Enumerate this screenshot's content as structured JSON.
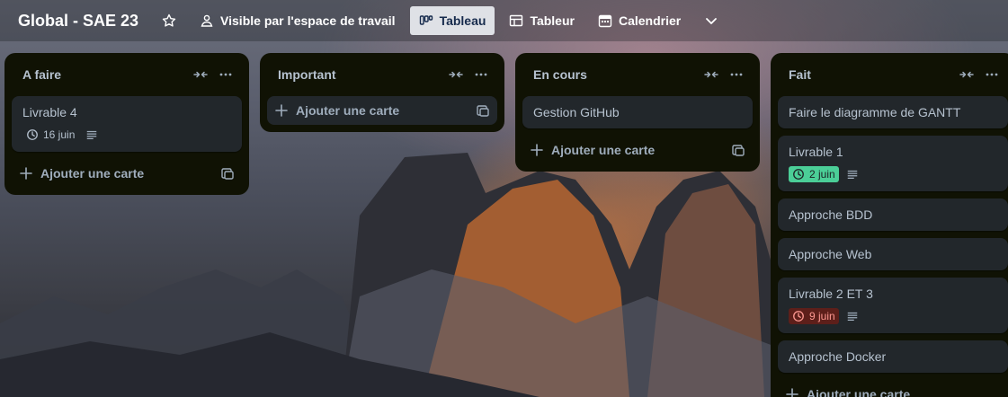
{
  "board": {
    "title": "Global - SAE 23",
    "visibility": "Visible par l'espace de travail",
    "views": [
      {
        "label": "Tableau",
        "active": true
      },
      {
        "label": "Tableur",
        "active": false
      },
      {
        "label": "Calendrier",
        "active": false
      }
    ]
  },
  "common": {
    "add_card": "Ajouter une carte"
  },
  "lists": [
    {
      "title": "A faire",
      "cards": [
        {
          "title": "Livrable 4",
          "due": "16 juin",
          "due_status": "normal",
          "has_description": true
        }
      ]
    },
    {
      "title": "Important",
      "cards": []
    },
    {
      "title": "En cours",
      "cards": [
        {
          "title": "Gestion GitHub"
        }
      ]
    },
    {
      "title": "Fait",
      "cards": [
        {
          "title": "Faire le diagramme de GANTT"
        },
        {
          "title": "Livrable 1",
          "due": "2 juin",
          "due_status": "complete",
          "has_description": true
        },
        {
          "title": "Approche BDD"
        },
        {
          "title": "Approche Web"
        },
        {
          "title": "Livrable 2 ET 3",
          "due": "9 juin",
          "due_status": "overdue",
          "has_description": true
        },
        {
          "title": "Approche Docker"
        }
      ]
    }
  ],
  "colors": {
    "list_bg": "#101204",
    "card_bg": "#22272b",
    "due_complete": "#4bce97",
    "due_overdue": "#5d1f1a"
  }
}
